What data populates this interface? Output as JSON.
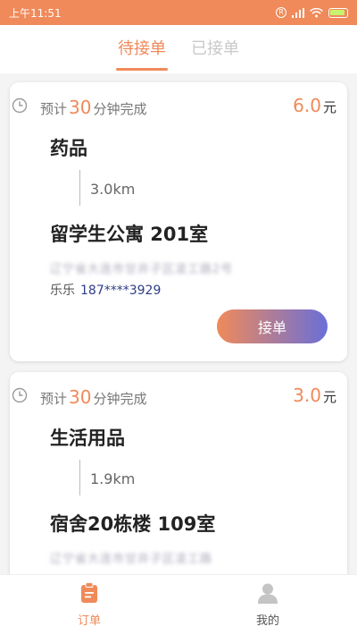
{
  "status_bar": {
    "time": "上午11:51"
  },
  "tabs": [
    {
      "label": "待接单",
      "active": true
    },
    {
      "label": "已接单",
      "active": false
    }
  ],
  "orders": [
    {
      "eta_prefix": "预计",
      "eta_minutes": "30",
      "eta_suffix": "分钟完成",
      "price": "6.0",
      "price_unit": "元",
      "item": "药品",
      "distance": "3.0km",
      "destination": "留学生公寓 201室",
      "address": "辽宁省大连市甘井子区凌工路2号",
      "contact_name": "乐乐",
      "contact_phone": "187****3929",
      "action_label": "接单"
    },
    {
      "eta_prefix": "预计",
      "eta_minutes": "30",
      "eta_suffix": "分钟完成",
      "price": "3.0",
      "price_unit": "元",
      "item": "生活用品",
      "distance": "1.9km",
      "destination": "宿舍20栋楼 109室",
      "address": "辽宁省大连市甘井子区凌工路"
    }
  ],
  "bottom_nav": [
    {
      "label": "订单",
      "icon": "clipboard-icon",
      "active": true
    },
    {
      "label": "我的",
      "icon": "user-icon",
      "active": false
    }
  ],
  "colors": {
    "accent": "#f08a5a",
    "gradient_end": "#6a6fd8",
    "phone": "#2f3d88"
  }
}
